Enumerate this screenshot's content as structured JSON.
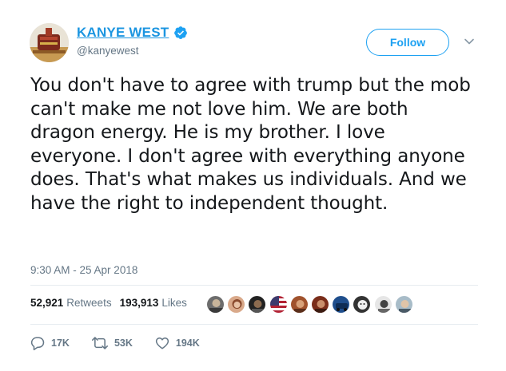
{
  "author": {
    "display_name": "KANYE WEST",
    "handle": "@kanyewest",
    "verified": true
  },
  "header": {
    "follow_label": "Follow"
  },
  "tweet": {
    "text": "You don't have to agree with trump but the mob can't make me not love him. We are both dragon energy. He is my brother. I love everyone. I don't agree with everything anyone does. That's what makes us individuals. And we have the right to independent thought.",
    "timestamp": "9:30 AM - 25 Apr 2018"
  },
  "stats": {
    "retweets_count": "52,921",
    "retweets_label": "Retweets",
    "likes_count": "193,913",
    "likes_label": "Likes"
  },
  "actions": {
    "replies": "17K",
    "retweets": "53K",
    "likes": "194K"
  },
  "colors": {
    "accent": "#1da1f2",
    "name_link": "#1b95e0",
    "muted": "#657786",
    "text": "#14171a",
    "divider": "#e6ecf0"
  },
  "icons": {
    "verified": "verified-badge-icon",
    "chevron": "chevron-down-icon",
    "reply": "reply-icon",
    "retweet": "retweet-icon",
    "like": "heart-icon"
  }
}
